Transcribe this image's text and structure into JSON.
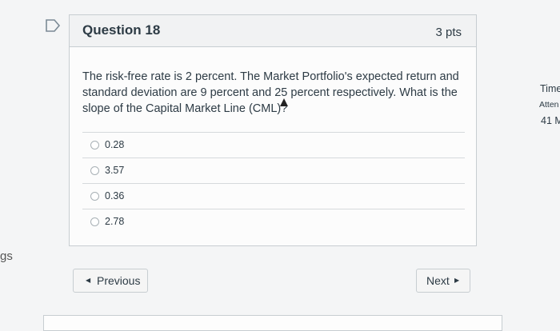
{
  "question": {
    "title": "Question 18",
    "points": "3 pts",
    "text": "The risk-free rate is 2 percent. The Market Portfolio's expected return and standard deviation are 9 percent and 25 percent respectively. What is the slope of the Capital Market Line (CML)?",
    "answers": [
      {
        "label": "0.28"
      },
      {
        "label": "3.57"
      },
      {
        "label": "0.36"
      },
      {
        "label": "2.78"
      }
    ]
  },
  "navigation": {
    "previous_label": "Previous",
    "next_label": "Next"
  },
  "side_panel": {
    "time_label": "Time",
    "attempt_label": "Atten",
    "minutes_label": "41 M"
  },
  "left_edge_text": "gs"
}
